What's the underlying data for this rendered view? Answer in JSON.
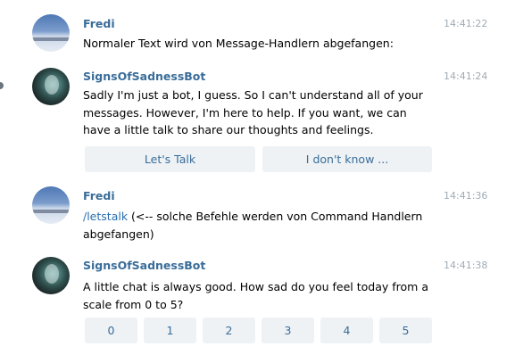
{
  "messages": [
    {
      "sender": "Fredi",
      "time": "14:41:22",
      "avatar": "beach-photo-avatar",
      "text": "Normaler Text wird von Message-Handlern abgefangen:"
    },
    {
      "sender": "SignsOfSadnessBot",
      "time": "14:41:24",
      "avatar": "bot-avatar",
      "text": "Sadly I'm just a bot, I guess. So I can't understand all of your messages. However, I'm here to help. If you want, we can have a little talk to share our thoughts and feelings.",
      "buttons": [
        "Let's Talk",
        "I don't know ..."
      ]
    },
    {
      "sender": "Fredi",
      "time": "14:41:36",
      "avatar": "beach-photo-avatar",
      "command": "/letstalk",
      "text": " (<-- solche Befehle werden von Command Handlern abgefangen)"
    },
    {
      "sender": "SignsOfSadnessBot",
      "time": "14:41:38",
      "avatar": "bot-avatar",
      "text": "A little chat is always good. How sad do you feel today from a scale from 0 to 5?",
      "buttons": [
        "0",
        "1",
        "2",
        "3",
        "4",
        "5"
      ]
    }
  ],
  "colors": {
    "sender": "#3a6d99",
    "link": "#2a6eb0",
    "timestamp": "#a0acb6",
    "keyboard_button_bg": "#eef2f5"
  }
}
